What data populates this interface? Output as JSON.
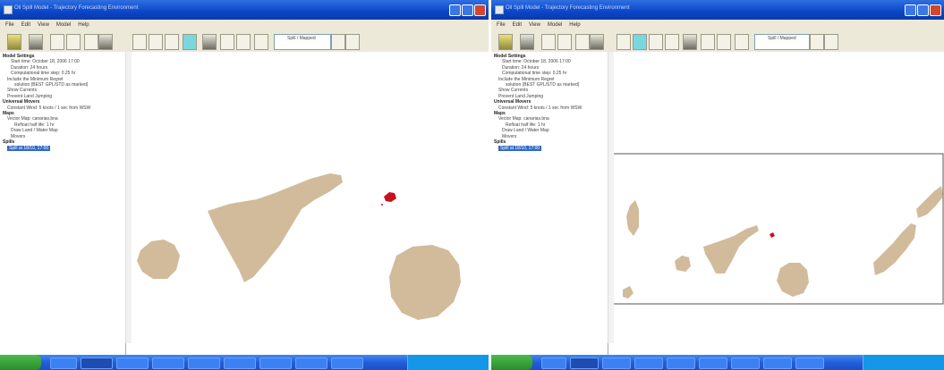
{
  "colors": {
    "titlebar": "#0a46c8",
    "menubar": "#ece9d8",
    "land": "#d1bb9b",
    "spill": "#c8101e",
    "selection": "#3169c6",
    "taskbar": "#245edb"
  },
  "left": {
    "title": "Oil Spill Model - Trajectory Forecasting Environment",
    "menu": [
      "File",
      "Edit",
      "View",
      "Model",
      "Help"
    ],
    "combo": "Spill / Mapped",
    "tree": [
      {
        "text": "Model Settings",
        "kind": "h"
      },
      {
        "text": "Start time: October 18, 2006 17:00",
        "kind": "i"
      },
      {
        "text": "Duration: 24 hours",
        "kind": "i"
      },
      {
        "text": "Computational time step: 0.25 hr",
        "kind": "i"
      },
      {
        "text": "Include the Minimum Regret",
        "kind": "i"
      },
      {
        "text": "solution (BEST GPL/STD as marked)",
        "kind": "i"
      },
      {
        "text": "Show Currents",
        "kind": "i"
      },
      {
        "text": "Prevent Land Jumping",
        "kind": "i"
      },
      {
        "text": "Universal Movers",
        "kind": "h"
      },
      {
        "text": "Constant Wind: 5 knots / 1 sec from WSW",
        "kind": "i"
      },
      {
        "text": "Maps",
        "kind": "h"
      },
      {
        "text": "Vector Map: canarias.bna",
        "kind": "i"
      },
      {
        "text": "Refloat half life: 1 hr",
        "kind": "i"
      },
      {
        "text": "Draw Land / Water Map",
        "kind": "i"
      },
      {
        "text": "Movers",
        "kind": "i"
      },
      {
        "text": "Spills",
        "kind": "h"
      },
      {
        "text": "Spill at 18/10, 17:00",
        "kind": "sel"
      }
    ]
  },
  "right": {
    "title": "Oil Spill Model - Trajectory Forecasting Environment",
    "menu": [
      "File",
      "Edit",
      "View",
      "Model",
      "Help"
    ],
    "combo": "Spill / Mapped",
    "tree": [
      {
        "text": "Model Settings",
        "kind": "h"
      },
      {
        "text": "Start time: October 18, 2006 17:00",
        "kind": "i"
      },
      {
        "text": "Duration: 24 hours",
        "kind": "i"
      },
      {
        "text": "Computational time step: 0.25 hr",
        "kind": "i"
      },
      {
        "text": "Include the Minimum Regret",
        "kind": "i"
      },
      {
        "text": "solution (BEST GPL/STD as marked)",
        "kind": "i"
      },
      {
        "text": "Show Currents",
        "kind": "i"
      },
      {
        "text": "Prevent Land Jumping",
        "kind": "i"
      },
      {
        "text": "Universal Movers",
        "kind": "h"
      },
      {
        "text": "Constant Wind: 5 knots / 1 sec from WSW",
        "kind": "i"
      },
      {
        "text": "Maps",
        "kind": "h"
      },
      {
        "text": "Vector Map: canarias.bna",
        "kind": "i"
      },
      {
        "text": "Refloat half life: 1 hr",
        "kind": "i"
      },
      {
        "text": "Draw Land / Water Map",
        "kind": "i"
      },
      {
        "text": "Movers",
        "kind": "i"
      },
      {
        "text": "Spills",
        "kind": "h"
      },
      {
        "text": "Spill at 18/10, 17:00",
        "kind": "sel"
      }
    ]
  },
  "icons": [
    "open-icon",
    "save-icon",
    "run-icon",
    "step-icon",
    "zoom-in-icon",
    "zoom-out-icon",
    "pan-icon",
    "hand-icon",
    "lasso-icon"
  ]
}
